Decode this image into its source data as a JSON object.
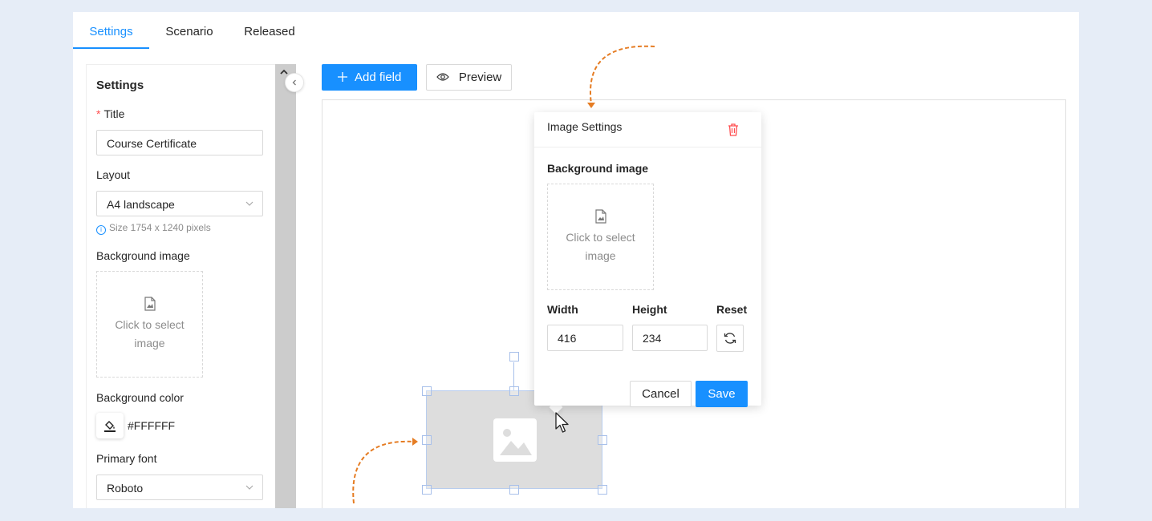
{
  "tabs": [
    {
      "label": "Settings",
      "active": true
    },
    {
      "label": "Scenario",
      "active": false
    },
    {
      "label": "Released",
      "active": false
    }
  ],
  "settings_panel": {
    "heading": "Settings",
    "title_label": "Title",
    "title_value": "Course Certificate",
    "layout_label": "Layout",
    "layout_value": "A4 landscape",
    "layout_hint": "Size 1754 x 1240 pixels",
    "bg_image_label": "Background image",
    "bg_image_placeholder": "Click to select image",
    "bg_color_label": "Background color",
    "bg_color_value": "#FFFFFF",
    "primary_font_label": "Primary font",
    "primary_font_value": "Roboto"
  },
  "toolbar": {
    "add_field_label": "Add field",
    "preview_label": "Preview"
  },
  "image_settings": {
    "title": "Image Settings",
    "bg_image_label": "Background image",
    "bg_image_placeholder": "Click to select image",
    "width_label": "Width",
    "height_label": "Height",
    "reset_label": "Reset",
    "width_value": "416",
    "height_value": "234",
    "cancel_label": "Cancel",
    "save_label": "Save"
  },
  "colors": {
    "accent": "#1890ff",
    "danger": "#ff4d4f",
    "annotation": "#e57c23",
    "background": "#e6edf7"
  },
  "icons": [
    "chevron-left-icon",
    "chevron-up-icon",
    "chevron-down-icon",
    "info-icon",
    "file-image-icon",
    "paint-bucket-icon",
    "plus-icon",
    "eye-icon",
    "trash-icon",
    "reload-icon",
    "image-icon",
    "mouse-cursor-icon"
  ]
}
